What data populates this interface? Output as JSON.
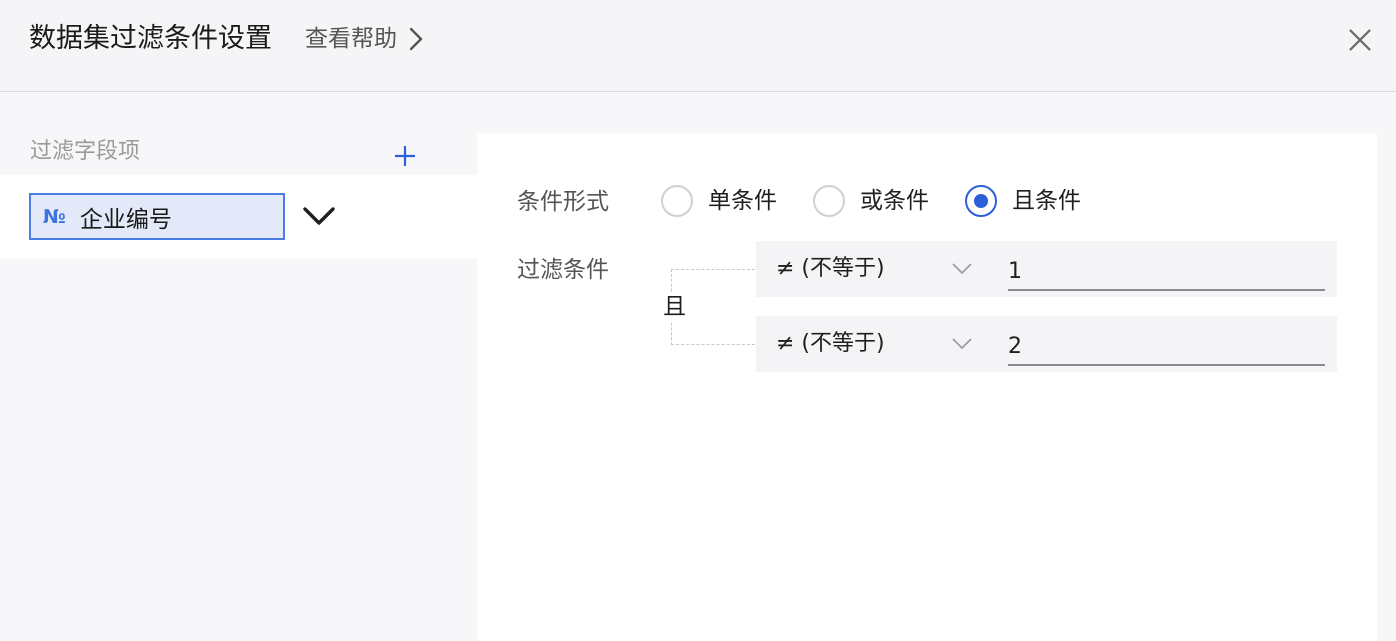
{
  "dialog": {
    "title": "数据集过滤条件设置",
    "help_label": "查看帮助"
  },
  "sidebar": {
    "label": "过滤字段项",
    "fields": [
      {
        "type_badge": "№",
        "name": "企业编号"
      }
    ]
  },
  "condition_form": {
    "label": "条件形式",
    "options": [
      {
        "label": "单条件",
        "checked": false
      },
      {
        "label": "或条件",
        "checked": false
      },
      {
        "label": "且条件",
        "checked": true
      }
    ]
  },
  "filter": {
    "label": "过滤条件",
    "logic": "且",
    "rows": [
      {
        "operator": "≠ (不等于)",
        "value": "1"
      },
      {
        "operator": "≠ (不等于)",
        "value": "2"
      }
    ]
  },
  "colors": {
    "accent": "#2c5fd9",
    "chip_bg": "#e3e9f8",
    "chip_border": "#4a7ee3"
  }
}
